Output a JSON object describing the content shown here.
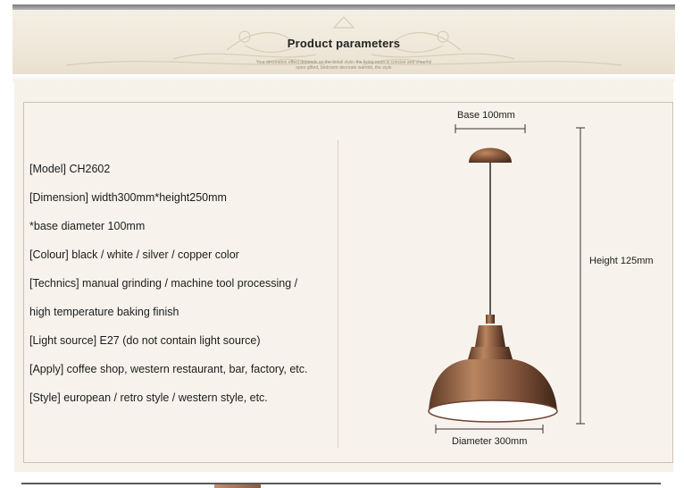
{
  "banner": {
    "title": "Product parameters",
    "subtitle_line1": "Your decoration effect depends on the detail style, the living room is concise and cheerful",
    "subtitle_line2": "open gifted, bedroom decorate warmth, the style"
  },
  "specs": [
    "[Model]  CH2602",
    "[Dimension]  width300mm*height250mm",
    "*base diameter 100mm",
    "[Colour]  black / white / silver / copper color",
    "[Technics]  manual grinding / machine tool processing /",
    "high temperature baking finish",
    "[Light source]  E27  (do not contain light source)",
    "[Apply]  coffee shop, western restaurant, bar, factory, etc.",
    "[Style]  european / retro style / western style, etc."
  ],
  "diagram": {
    "base_label": "Base 100mm",
    "height_label": "Height 125mm",
    "diameter_label": "Diameter 300mm"
  },
  "colors": {
    "banner_bg": "#efe8da",
    "panel_bg": "#f6f2ea",
    "lamp_copper": "#8a5a3f",
    "lamp_inner": "#ffffff"
  }
}
